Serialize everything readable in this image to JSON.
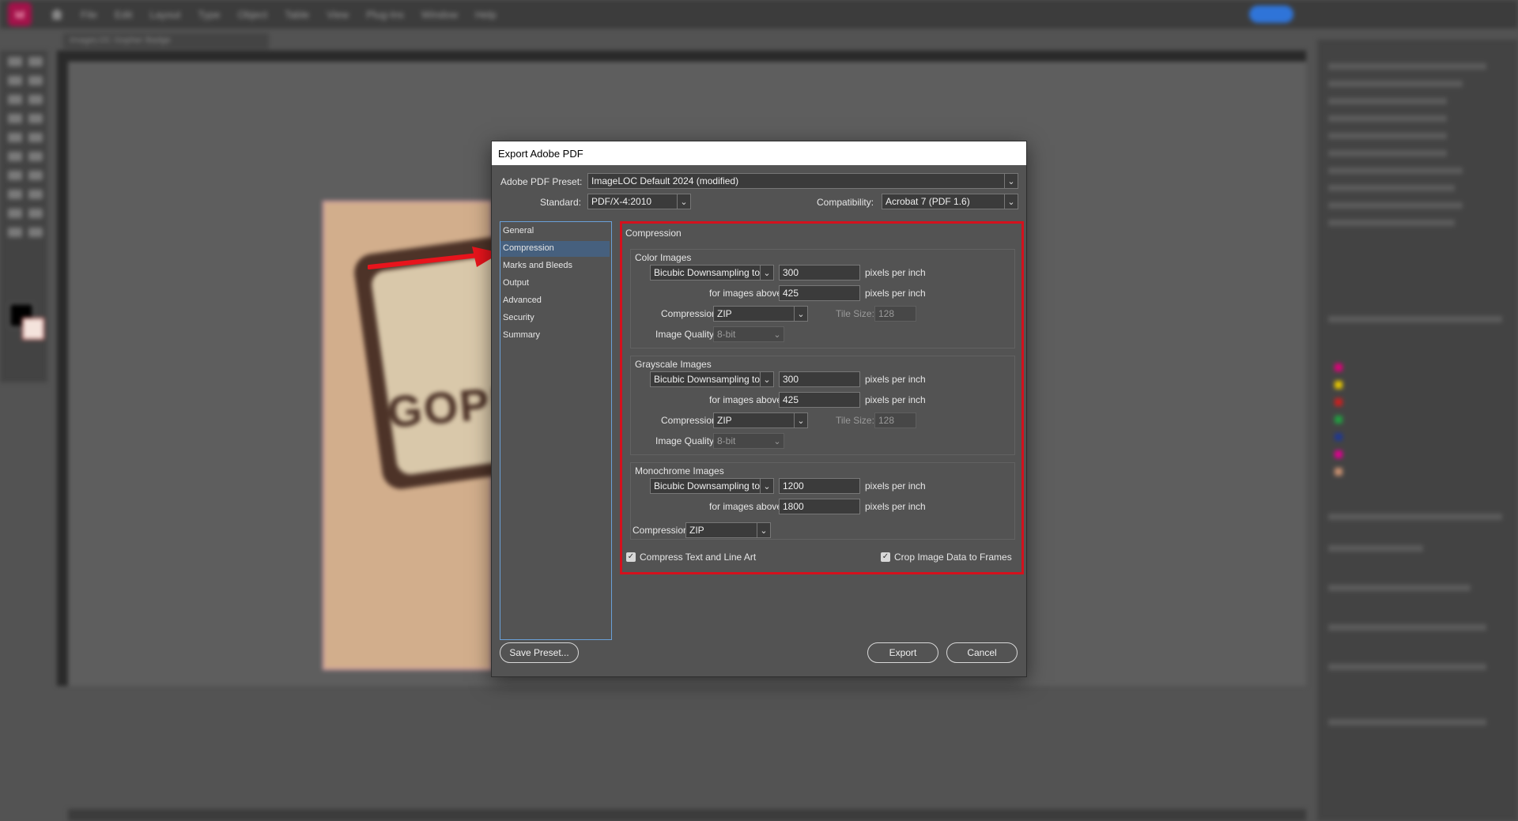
{
  "app": {
    "logo_text": "Id",
    "menu": [
      "File",
      "Edit",
      "Layout",
      "Type",
      "Object",
      "Table",
      "View",
      "Plug-Ins",
      "Window",
      "Help"
    ],
    "document_tab": "ImageLOC Gopher Badge",
    "canvas_text": "GOPHE"
  },
  "dialog": {
    "title": "Export Adobe PDF",
    "preset_label": "Adobe PDF Preset:",
    "preset_value": "ImageLOC Default 2024 (modified)",
    "standard_label": "Standard:",
    "standard_value": "PDF/X-4:2010",
    "compat_label": "Compatibility:",
    "compat_value": "Acrobat 7 (PDF 1.6)",
    "nav": [
      "General",
      "Compression",
      "Marks and Bleeds",
      "Output",
      "Advanced",
      "Security",
      "Summary"
    ],
    "section_title": "Compression",
    "color": {
      "title": "Color Images",
      "method": "Bicubic Downsampling to",
      "ppi": "300",
      "ppi_unit": "pixels per inch",
      "above_label": "for images above:",
      "above_value": "425",
      "compression_label": "Compression:",
      "compression_value": "ZIP",
      "tile_label": "Tile Size:",
      "tile_value": "128",
      "quality_label": "Image Quality:",
      "quality_value": "8-bit"
    },
    "gray": {
      "title": "Grayscale Images",
      "method": "Bicubic Downsampling to",
      "ppi": "300",
      "ppi_unit": "pixels per inch",
      "above_label": "for images above:",
      "above_value": "425",
      "compression_label": "Compression:",
      "compression_value": "ZIP",
      "tile_label": "Tile Size:",
      "tile_value": "128",
      "quality_label": "Image Quality:",
      "quality_value": "8-bit"
    },
    "mono": {
      "title": "Monochrome Images",
      "method": "Bicubic Downsampling to",
      "ppi": "1200",
      "ppi_unit": "pixels per inch",
      "above_label": "for images above:",
      "above_value": "1800",
      "compression_label": "Compression:",
      "compression_value": "ZIP"
    },
    "compress_text": "Compress Text and Line Art",
    "crop_image": "Crop Image Data to Frames",
    "save_preset": "Save Preset...",
    "export": "Export",
    "cancel": "Cancel"
  },
  "colors": {
    "highlight": "#d4111d",
    "nav_selected": "#46607e",
    "dialog_bg": "#535353"
  }
}
